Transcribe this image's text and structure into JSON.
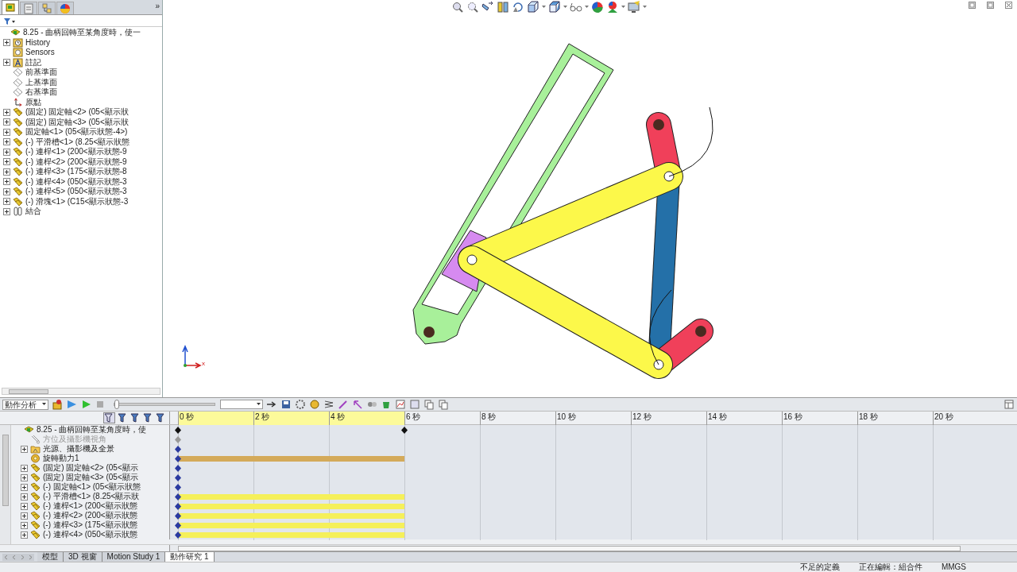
{
  "feature_manager": {
    "tabs": [
      {
        "kind": "tree",
        "selected": true
      },
      {
        "kind": "property",
        "selected": false
      },
      {
        "kind": "config",
        "selected": false
      },
      {
        "kind": "display",
        "selected": false
      }
    ],
    "more": "»",
    "root": {
      "label": "8.25 - 曲柄回轉至某角度時，使一",
      "kind": "assembly",
      "children": [
        {
          "label": "History",
          "kind": "history",
          "expandable": true
        },
        {
          "label": "Sensors",
          "kind": "sensor",
          "expandable": false
        },
        {
          "label": "註記",
          "kind": "annotation",
          "expandable": true
        },
        {
          "label": "前基準面",
          "kind": "plane",
          "expandable": false
        },
        {
          "label": "上基準面",
          "kind": "plane",
          "expandable": false
        },
        {
          "label": "右基準面",
          "kind": "plane",
          "expandable": false
        },
        {
          "label": "原點",
          "kind": "origin",
          "expandable": false
        },
        {
          "label": "(固定) 固定軸<2> (05<顯示狀",
          "kind": "part",
          "expandable": true
        },
        {
          "label": "(固定) 固定軸<3> (05<顯示狀",
          "kind": "part",
          "expandable": true
        },
        {
          "label": "固定軸<1> (05<顯示狀態-4>)",
          "kind": "part",
          "expandable": true
        },
        {
          "label": "(-) 平滑槽<1> (8.25<顯示狀態",
          "kind": "part",
          "expandable": true
        },
        {
          "label": "(-) 連桿<1> (200<顯示狀態-9",
          "kind": "part",
          "expandable": true
        },
        {
          "label": "(-) 連桿<2> (200<顯示狀態-9",
          "kind": "part",
          "expandable": true
        },
        {
          "label": "(-) 連桿<3> (175<顯示狀態-8",
          "kind": "part",
          "expandable": true
        },
        {
          "label": "(-) 連桿<4> (050<顯示狀態-3",
          "kind": "part",
          "expandable": true
        },
        {
          "label": "(-) 連桿<5> (050<顯示狀態-3",
          "kind": "part",
          "expandable": true
        },
        {
          "label": "(-) 滑塊<1> (C15<顯示狀態-3",
          "kind": "part",
          "expandable": true
        },
        {
          "label": "結合",
          "kind": "mate",
          "expandable": true
        }
      ]
    }
  },
  "triad": {
    "x_label": "x"
  },
  "motion_manager": {
    "study_type": "動作分析",
    "time_slider": {
      "level": 0
    },
    "time_ticks": [
      "0 秒",
      "2 秒",
      "4 秒",
      "6 秒",
      "8 秒",
      "10 秒",
      "12 秒",
      "14 秒",
      "16 秒",
      "18 秒",
      "20 秒"
    ],
    "root": {
      "label": "8.25 - 曲柄回轉至某角度時，使",
      "kind": "assembly",
      "children": [
        {
          "label": "方位及攝影機視角",
          "kind": "camera",
          "expandable": false,
          "disabled": true
        },
        {
          "label": "光源、攝影機及全景",
          "kind": "lights",
          "expandable": true,
          "disabled": false
        },
        {
          "label": "旋轉動力1",
          "kind": "motor",
          "expandable": false,
          "disabled": false,
          "color": "#d4aa5a"
        },
        {
          "label": "(固定) 固定軸<2> (05<顯示",
          "kind": "part",
          "expandable": true,
          "disabled": false
        },
        {
          "label": "(固定) 固定軸<3> (05<顯示",
          "kind": "part",
          "expandable": true,
          "disabled": false
        },
        {
          "label": "(-) 固定軸<1> (05<顯示狀態",
          "kind": "part",
          "expandable": true,
          "disabled": false
        },
        {
          "label": "(-) 平滑槽<1> (8.25<顯示狀",
          "kind": "part",
          "expandable": true,
          "disabled": false,
          "color": "#f5f05a"
        },
        {
          "label": "(-) 連桿<1> (200<顯示狀態",
          "kind": "part",
          "expandable": true,
          "disabled": false,
          "color": "#f5f05a"
        },
        {
          "label": "(-) 連桿<2> (200<顯示狀態",
          "kind": "part",
          "expandable": true,
          "disabled": false,
          "color": "#f5f05a"
        },
        {
          "label": "(-) 連桿<3> (175<顯示狀態",
          "kind": "part",
          "expandable": true,
          "disabled": false,
          "color": "#f5f05a"
        },
        {
          "label": "(-) 連桿<4> (050<顯示狀態",
          "kind": "part",
          "expandable": true,
          "disabled": false,
          "color": "#f5f05a"
        }
      ]
    }
  },
  "bottom_tabs": [
    {
      "label": "模型",
      "selected": false
    },
    {
      "label": "3D 視窗",
      "selected": false
    },
    {
      "label": "Motion Study 1",
      "selected": false
    },
    {
      "label": "動作研究 1",
      "selected": true
    }
  ],
  "status_bar": {
    "definition": "不足的定義",
    "editing": "正在編輯：組合件",
    "units": "MMGS"
  }
}
